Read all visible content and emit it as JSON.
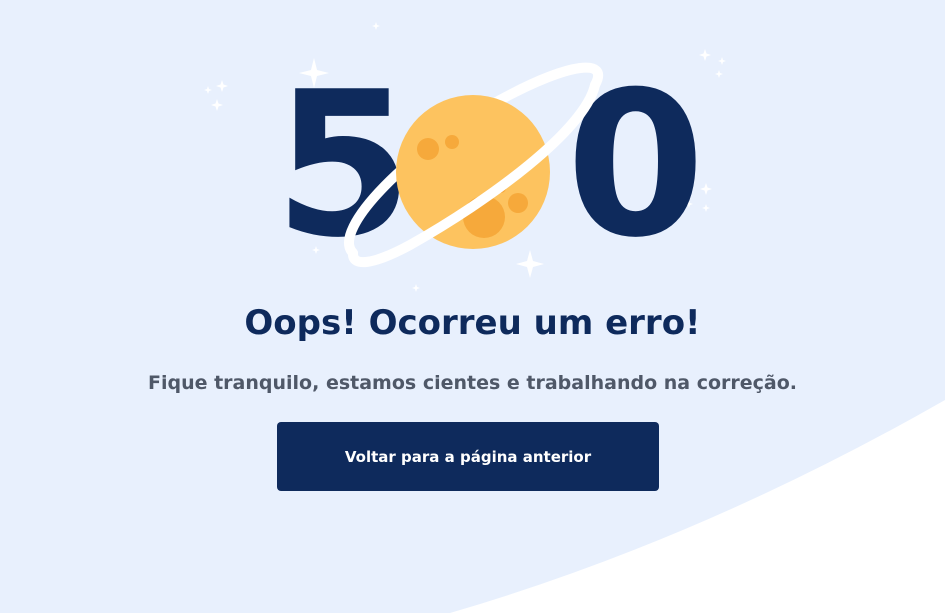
{
  "error": {
    "code_first": "5",
    "code_last": "0",
    "title": "Oops! Ocorreu um erro!",
    "message": "Fique tranquilo, estamos cientes e trabalhando na correção."
  },
  "actions": {
    "back_label": "Voltar para a página anterior"
  },
  "colors": {
    "background": "#e8f0fd",
    "primary": "#0e2a5c",
    "planet": "#fdc35f",
    "planet_crater": "#f6a93b",
    "text_secondary": "#4f5868"
  },
  "icons": [
    "planet-icon",
    "sparkle-icon"
  ]
}
